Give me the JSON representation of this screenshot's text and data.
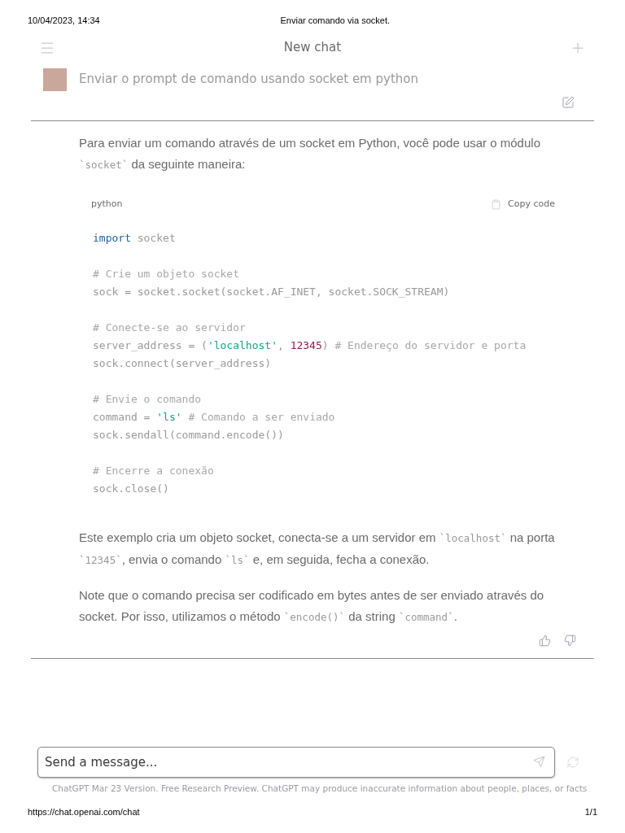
{
  "print_header": {
    "date": "10/04/2023, 14:34",
    "title": "Enviar comando via socket."
  },
  "top_bar": {
    "title": "New chat"
  },
  "user_message": {
    "text": "Enviar o prompt de comando usando socket em python"
  },
  "answer": {
    "intro": [
      {
        "kind": "text",
        "text": "Para enviar um comando através de um socket em Python, você pode usar o módulo "
      },
      {
        "kind": "code",
        "text": "`socket`"
      },
      {
        "kind": "text",
        "text": " da seguinte maneira:"
      }
    ],
    "code_block": {
      "language": "python",
      "copy_label": "Copy code",
      "lines": [
        {
          "kind": "code",
          "tokens": [
            {
              "kind": "keyword",
              "text": "import"
            },
            {
              "kind": "plain",
              "text": " socket"
            }
          ]
        },
        {
          "kind": "blank"
        },
        {
          "kind": "code",
          "tokens": [
            {
              "kind": "comment",
              "text": "# Crie um objeto socket"
            }
          ]
        },
        {
          "kind": "code",
          "tokens": [
            {
              "kind": "plain",
              "text": "sock = socket.socket(socket.AF_INET, socket.SOCK_STREAM)"
            }
          ]
        },
        {
          "kind": "blank"
        },
        {
          "kind": "code",
          "tokens": [
            {
              "kind": "comment",
              "text": "# Conecte-se ao servidor"
            }
          ]
        },
        {
          "kind": "code",
          "tokens": [
            {
              "kind": "plain",
              "text": "server_address = ("
            },
            {
              "kind": "string",
              "text": "'localhost'"
            },
            {
              "kind": "plain",
              "text": ", "
            },
            {
              "kind": "number",
              "text": "12345"
            },
            {
              "kind": "plain",
              "text": ") "
            },
            {
              "kind": "comment",
              "text": "# Endereço do servidor e porta"
            }
          ]
        },
        {
          "kind": "code",
          "tokens": [
            {
              "kind": "plain",
              "text": "sock.connect(server_address)"
            }
          ]
        },
        {
          "kind": "blank"
        },
        {
          "kind": "code",
          "tokens": [
            {
              "kind": "comment",
              "text": "# Envie o comando"
            }
          ]
        },
        {
          "kind": "code",
          "tokens": [
            {
              "kind": "plain",
              "text": "command = "
            },
            {
              "kind": "string",
              "text": "'ls'"
            },
            {
              "kind": "comment",
              "text": " # Comando a ser enviado"
            }
          ]
        },
        {
          "kind": "code",
          "tokens": [
            {
              "kind": "plain",
              "text": "sock.sendall(command.encode())"
            }
          ]
        },
        {
          "kind": "blank"
        },
        {
          "kind": "code",
          "tokens": [
            {
              "kind": "comment",
              "text": "# Encerre a conexão"
            }
          ]
        },
        {
          "kind": "code",
          "tokens": [
            {
              "kind": "plain",
              "text": "sock.close()"
            }
          ]
        }
      ]
    },
    "paragraphs": [
      [
        {
          "kind": "text",
          "text": "Este exemplo cria um objeto socket, conecta-se a um servidor em "
        },
        {
          "kind": "code",
          "text": "`localhost`"
        },
        {
          "kind": "text",
          "text": " na porta "
        },
        {
          "kind": "code",
          "text": "`12345`"
        },
        {
          "kind": "text",
          "text": ", envia o comando "
        },
        {
          "kind": "code",
          "text": "`ls`"
        },
        {
          "kind": "text",
          "text": " e, em seguida, fecha a conexão."
        }
      ],
      [
        {
          "kind": "text",
          "text": "Note que o comando precisa ser codificado em bytes antes de ser enviado através do socket. Por isso, utilizamos o método "
        },
        {
          "kind": "code",
          "text": "`encode()`"
        },
        {
          "kind": "text",
          "text": " da string "
        },
        {
          "kind": "code",
          "text": "`command`"
        },
        {
          "kind": "text",
          "text": "."
        }
      ]
    ]
  },
  "composer": {
    "placeholder": "Send a message...",
    "disclaimer": "ChatGPT Mar 23 Version. Free Research Preview. ChatGPT may produce inaccurate information about people, places, or facts"
  },
  "print_footer": {
    "url": "https://chat.openai.com/chat",
    "page": "1/1"
  }
}
